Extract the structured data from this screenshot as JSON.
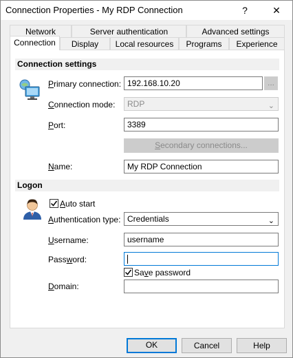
{
  "window": {
    "title": "Connection Properties - My RDP Connection",
    "help_glyph": "?",
    "close_glyph": "✕"
  },
  "tabs": {
    "row1": [
      "Network",
      "Server authentication",
      "Advanced settings"
    ],
    "row2": [
      "Connection",
      "Display",
      "Local resources",
      "Programs",
      "Experience"
    ],
    "active": "Connection"
  },
  "connection_settings": {
    "heading": "Connection settings",
    "icon": "computer-monitor-icon",
    "primary_connection": {
      "label_u": "P",
      "label_rest": "rimary connection:",
      "value": "192.168.10.20",
      "browse_label": "..."
    },
    "connection_mode": {
      "label_u": "C",
      "label_rest": "onnection mode:",
      "value": "RDP"
    },
    "port": {
      "label_u": "P",
      "label_rest": "ort:",
      "value": "3389"
    },
    "secondary_button": {
      "label_u": "S",
      "label_rest": "econdary connections..."
    },
    "name": {
      "label_u": "N",
      "label_rest": "ame:",
      "value": "My RDP Connection"
    }
  },
  "logon": {
    "heading": "Logon",
    "icon": "user-avatar-icon",
    "auto_start": {
      "label_u": "A",
      "label_rest": "uto start",
      "checked": true
    },
    "auth_type": {
      "label_u": "A",
      "label_rest": "uthentication type:",
      "value": "Credentials"
    },
    "username": {
      "label_u": "U",
      "label_rest": "sername:",
      "value": "username"
    },
    "password": {
      "label_pre": "Pass",
      "label_u": "w",
      "label_rest": "ord:",
      "value": ""
    },
    "save_password": {
      "label_pre": "Sa",
      "label_u": "v",
      "label_rest": "e password",
      "checked": true
    },
    "domain": {
      "label_u": "D",
      "label_rest": "omain:",
      "value": ""
    }
  },
  "footer": {
    "ok": "OK",
    "cancel": "Cancel",
    "help": "Help"
  },
  "colors": {
    "accent": "#0078d7",
    "section_bg": "#f0f0f0"
  }
}
